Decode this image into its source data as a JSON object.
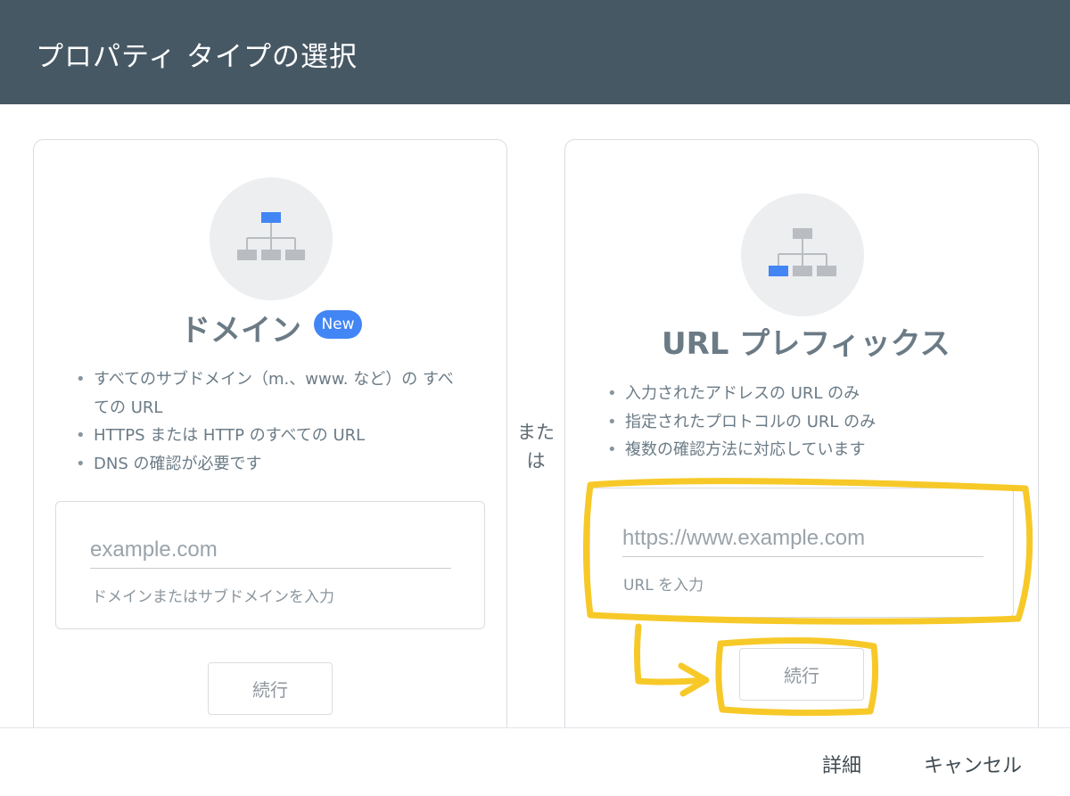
{
  "header": {
    "title": "プロパティ タイプの選択"
  },
  "domain_card": {
    "title": "ドメイン",
    "badge": "New",
    "bullets": [
      "すべてのサブドメイン（m.、www. など）の すべての URL",
      "HTTPS または HTTP のすべての URL",
      "DNS の確認が必要です"
    ],
    "input_placeholder": "example.com",
    "input_value": "",
    "helper": "ドメインまたはサブドメインを入力",
    "continue_label": "続行",
    "icon": "sitemap-icon"
  },
  "or_label": "または",
  "url_card": {
    "title": "URL プレフィックス",
    "bullets": [
      "入力されたアドレスの URL のみ",
      "指定されたプロトコルの URL のみ",
      "複数の確認方法に対応しています"
    ],
    "input_placeholder": "https://www.example.com",
    "input_value": "",
    "helper": "URL を入力",
    "continue_label": "続行",
    "icon": "sitemap-icon"
  },
  "footer": {
    "details_label": "詳細",
    "cancel_label": "キャンセル"
  },
  "colors": {
    "header_bg": "#475865",
    "accent": "#4285f4",
    "highlight": "#f7c928"
  }
}
